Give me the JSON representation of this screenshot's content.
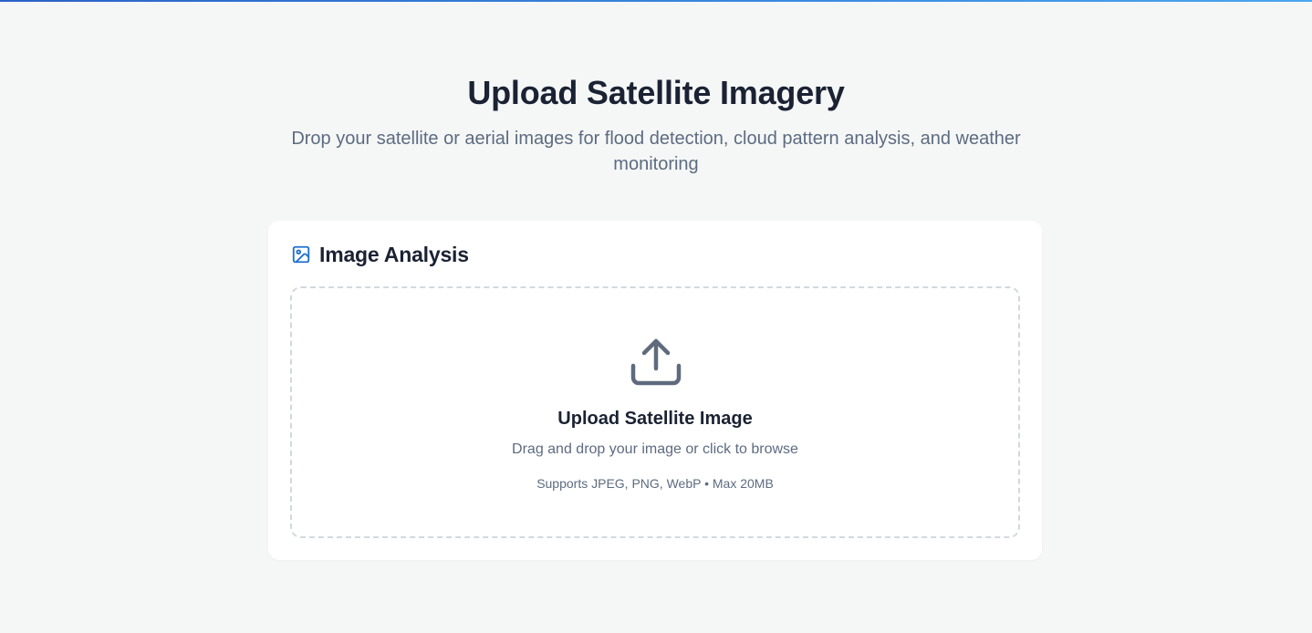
{
  "header": {
    "title": "Upload Satellite Imagery",
    "subtitle": "Drop your satellite or aerial images for flood detection, cloud pattern analysis, and weather monitoring"
  },
  "card": {
    "icon": "image-icon",
    "title": "Image Analysis"
  },
  "dropzone": {
    "icon": "upload-icon",
    "title": "Upload Satellite Image",
    "description": "Drag and drop your image or click to browse",
    "note": "Supports JPEG, PNG, WebP • Max 20MB"
  },
  "colors": {
    "accent": "#1f6fd1",
    "background": "#f5f7f7",
    "text_primary": "#1a2233",
    "text_secondary": "#5d6b80",
    "icon_gray": "#5f6b7d",
    "dashed_border": "#d3d8de"
  }
}
